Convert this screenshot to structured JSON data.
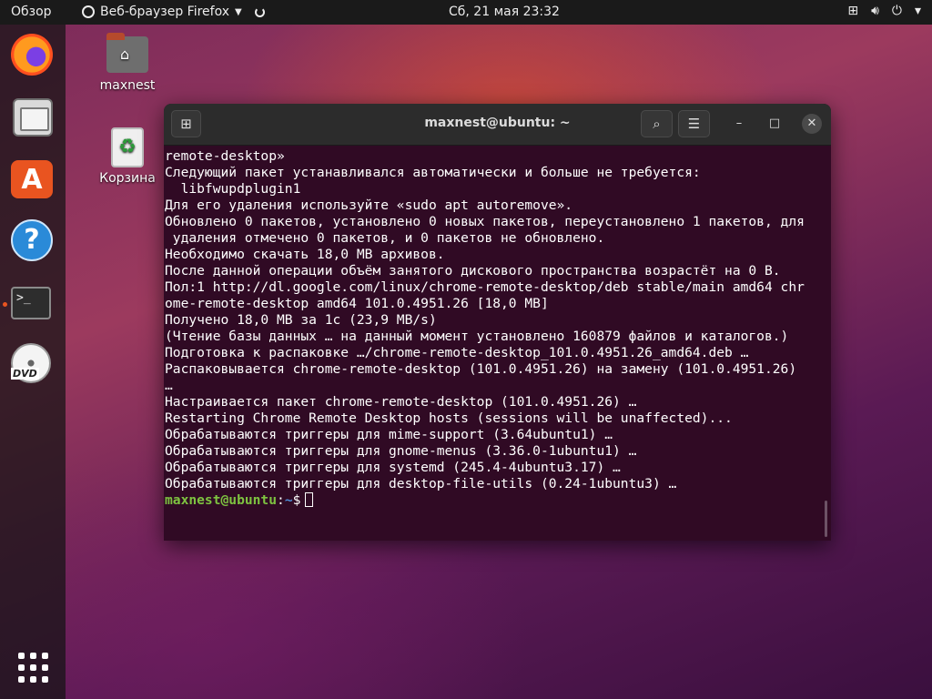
{
  "topbar": {
    "overview": "Обзор",
    "app_name": "Веб-браузер Firefox",
    "clock": "Сб, 21 мая  23:32",
    "tray_icons": [
      "network-icon",
      "volume-icon",
      "power-icon",
      "chevron-down-icon"
    ]
  },
  "dock": {
    "items": [
      "firefox-icon",
      "files-icon",
      "software-icon",
      "help-icon",
      "terminal-icon",
      "dvd-icon"
    ],
    "terminal_icon_text": ">_",
    "dvd_label": "DVD"
  },
  "desktop": {
    "home_label": "maxnest",
    "trash_label": "Корзина"
  },
  "terminal": {
    "title": "maxnest@ubuntu: ~",
    "lines": [
      "remote-desktop»",
      "Следующий пакет устанавливался автоматически и больше не требуется:",
      "  libfwupdplugin1",
      "Для его удаления используйте «sudo apt autoremove».",
      "Обновлено 0 пакетов, установлено 0 новых пакетов, переустановлено 1 пакетов, для",
      " удаления отмечено 0 пакетов, и 0 пакетов не обновлено.",
      "Необходимо скачать 18,0 MB архивов.",
      "После данной операции объём занятого дискового пространства возрастёт на 0 B.",
      "Пол:1 http://dl.google.com/linux/chrome-remote-desktop/deb stable/main amd64 chr",
      "ome-remote-desktop amd64 101.0.4951.26 [18,0 MB]",
      "Получено 18,0 MB за 1с (23,9 MB/s)",
      "(Чтение базы данных … на данный момент установлено 160879 файлов и каталогов.)",
      "Подготовка к распаковке …/chrome-remote-desktop_101.0.4951.26_amd64.deb …",
      "Распаковывается chrome-remote-desktop (101.0.4951.26) на замену (101.0.4951.26)",
      "…",
      "Настраивается пакет chrome-remote-desktop (101.0.4951.26) …",
      "Restarting Chrome Remote Desktop hosts (sessions will be unaffected)...",
      "Обрабатываются триггеры для mime-support (3.64ubuntu1) …",
      "Обрабатываются триггеры для gnome-menus (3.36.0-1ubuntu1) …",
      "Обрабатываются триггеры для systemd (245.4-4ubuntu3.17) …",
      "Обрабатываются триггеры для desktop-file-utils (0.24-1ubuntu3) …"
    ],
    "prompt_user": "maxnest@ubuntu",
    "prompt_sep": ":",
    "prompt_path": "~",
    "prompt_symbol": "$"
  }
}
